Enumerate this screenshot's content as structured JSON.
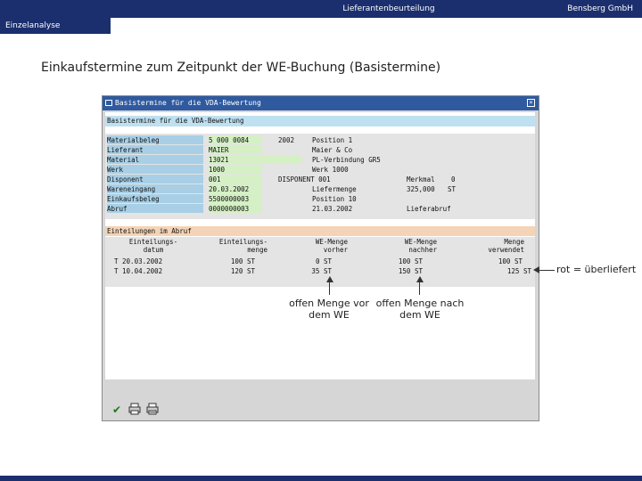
{
  "header": {
    "center": "Lieferantenbeurteilung",
    "right": "Bensberg GmbH"
  },
  "tab": {
    "label": "Einzelanalyse"
  },
  "page_title": "Einkaufstermine zum Zeitpunkt der WE-Buchung (Basistermine)",
  "sap": {
    "window_title": "Basistermine für die VDA-Bewertung",
    "section_title": "Basistermine für die VDA-Bewertung",
    "fields": [
      {
        "label": "Materialbeleg",
        "value": "5 000 0084",
        "extra1": "2002",
        "extra2": "Position 1",
        "extra3": "",
        "extra4": ""
      },
      {
        "label": "Lieferant",
        "value": "MAIER",
        "extra1": "",
        "extra2": "Maier & Co",
        "extra3": "",
        "extra4": ""
      },
      {
        "label": "Material",
        "value": "13021",
        "extra1": "",
        "extra2": "PL-Verbindung GR5",
        "extra3": "",
        "extra4": ""
      },
      {
        "label": "Werk",
        "value": "1000",
        "extra1": "",
        "extra2": "Werk 1000",
        "extra3": "",
        "extra4": ""
      },
      {
        "label": "Disponent",
        "value": "001",
        "extra1": "",
        "extra2": "DISPONENT 001",
        "extra3": "Merkmal",
        "extra4": "0"
      },
      {
        "label": "Wareneingang",
        "value": "20.03.2002",
        "extra1": "",
        "extra2": "Liefermenge",
        "extra3": "325,000",
        "extra4": "ST"
      },
      {
        "label": "Einkaufsbeleg",
        "value": "5500000003",
        "extra1": "",
        "extra2": "Position 10",
        "extra3": "",
        "extra4": ""
      },
      {
        "label": "Abruf",
        "value": "0000000003",
        "extra1": "",
        "extra2": "21.03.2002",
        "extra3": "Lieferabruf",
        "extra4": ""
      }
    ],
    "schedule_title": "Einteilungen im Abruf",
    "columns": [
      {
        "line1": "Einteilungs-",
        "line2": "datum"
      },
      {
        "line1": "Einteilungs-",
        "line2": "menge"
      },
      {
        "line1": "WE-Menge",
        "line2": "vorher"
      },
      {
        "line1": "WE-Menge",
        "line2": "nachher"
      },
      {
        "line1": "Menge",
        "line2": "verwendet"
      }
    ],
    "rows": [
      {
        "datum": "T 20.03.2002",
        "menge": "100  ST",
        "vorher": "0  ST",
        "nachher": "100  ST",
        "verwendet": "100  ST"
      },
      {
        "datum": "T 10.04.2002",
        "menge": "120  ST",
        "vorher": "35  ST",
        "nachher": "150  ST",
        "verwendet": "125  ST"
      }
    ]
  },
  "annotations": {
    "before": "offen Menge vor dem WE",
    "after": "offen Menge nach dem WE",
    "red": "rot = überliefert"
  }
}
